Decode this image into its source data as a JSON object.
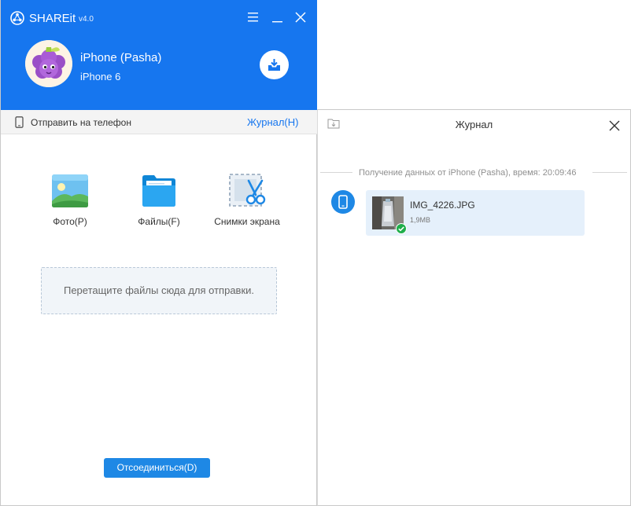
{
  "app": {
    "name": "SHAREit",
    "version": "v4.0"
  },
  "device": {
    "name": "iPhone (Pasha)",
    "model": "iPhone 6"
  },
  "toolbar": {
    "send_to_phone": "Отправить на телефон",
    "journal_link": "Журнал(H)"
  },
  "tiles": [
    {
      "label": "Фото(P)",
      "icon": "photo-icon"
    },
    {
      "label": "Файлы(F)",
      "icon": "folder-icon"
    },
    {
      "label": "Снимки экрана",
      "icon": "screenshot-scissors-icon"
    }
  ],
  "dropzone": {
    "text": "Перетащите файлы сюда для отправки."
  },
  "disconnect_button": "Отсоединиться(D)",
  "journal": {
    "title": "Журнал",
    "separator_text": "Получение данных от iPhone (Pasha), время: 20:09:46",
    "items": [
      {
        "file_name": "IMG_4226.JPG",
        "size": "1,9MB",
        "status": "received"
      }
    ]
  },
  "colors": {
    "header_blue": "#1676ef",
    "button_blue": "#1e88e5",
    "card_bg": "#e5f0fb",
    "success_green": "#1fae4b"
  }
}
